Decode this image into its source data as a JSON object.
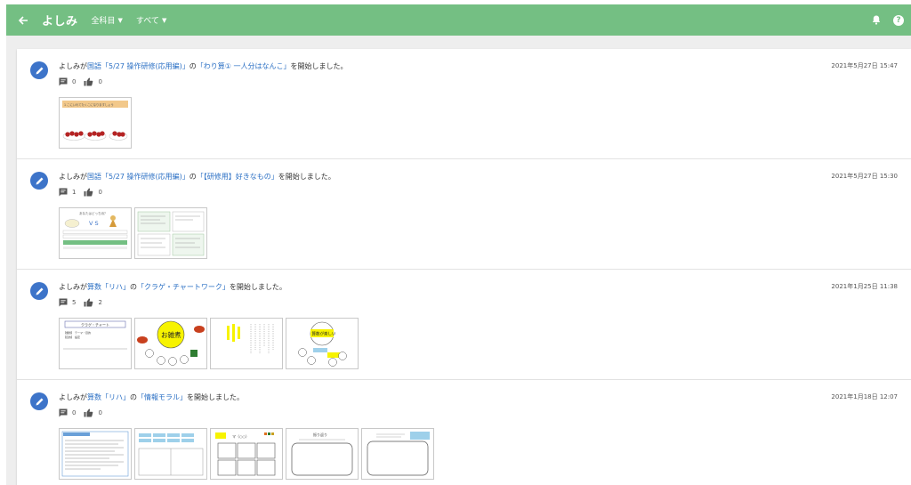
{
  "header": {
    "title": "よしみ",
    "subject_filter": "全科目",
    "scope_filter": "すべて",
    "back_icon": "arrow-left-icon",
    "bell_icon": "bell-icon",
    "help_icon": "help-icon",
    "help_glyph": "?",
    "color": "#74bf83"
  },
  "posts": [
    {
      "user": "よしみが",
      "subject": "国語「5/27 操作研修(応用編)」",
      "mid": "の",
      "activity": "「わり算① 一人分はなんこ」",
      "tail": "を開始しました。",
      "date": "2021年5月27日 15:47",
      "comments": "0",
      "likes": "0"
    },
    {
      "user": "よしみが",
      "subject": "国語「5/27 操作研修(応用編)」",
      "mid": "の",
      "activity": "「【研修用】好きなもの」",
      "tail": "を開始しました。",
      "date": "2021年5月27日 15:30",
      "comments": "1",
      "likes": "0"
    },
    {
      "user": "よしみが",
      "subject": "算数「リハ」",
      "mid": "の",
      "activity": "「クラゲ・チャートワーク」",
      "tail": "を開始しました。",
      "date": "2021年1月25日 11:38",
      "comments": "5",
      "likes": "2"
    },
    {
      "user": "よしみが",
      "subject": "算数「リハ」",
      "mid": "の",
      "activity": "「情報モラル」",
      "tail": "を開始しました。",
      "date": "2021年1月18日 12:07",
      "comments": "0",
      "likes": "0"
    }
  ],
  "thumb_text": {
    "t1_banner": "1 こにいれてたくこになりますしょう",
    "t3_vs": "V S",
    "t3_heading": "あなたはどっち派？",
    "t5_title": "クラゲ・チャート",
    "t5_line1": "【課題】 テーマ・目的",
    "t5_line2": "【目的】 設定",
    "t6_bubble": "お雑煮",
    "t8_bubble": "算数が楽しい",
    "t10_label": "マ（○○）",
    "t12_title": "振り返り"
  }
}
